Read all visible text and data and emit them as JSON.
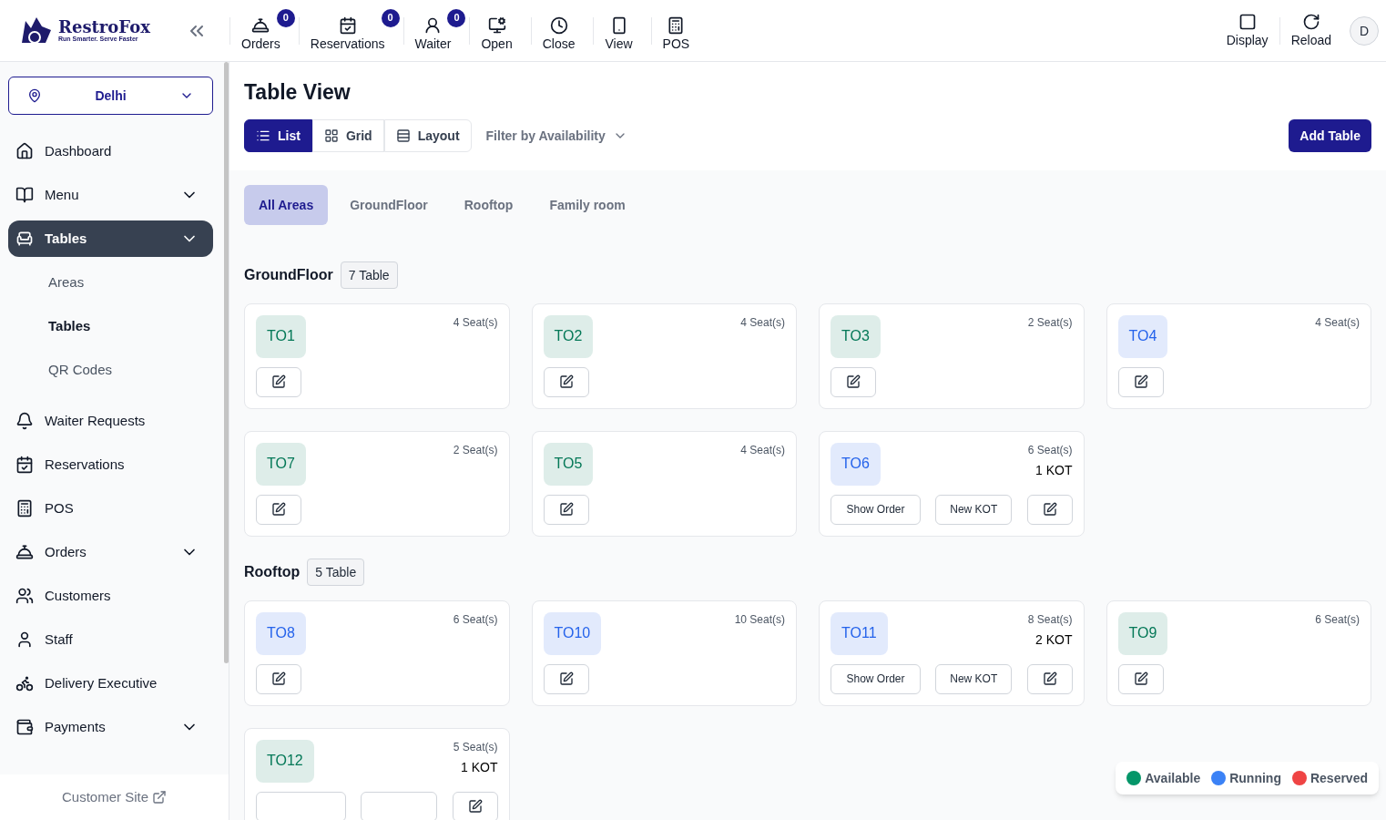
{
  "brand": {
    "name": "RestroFox",
    "tagline": "Run Smarter. Serve Faster"
  },
  "toolbar": [
    {
      "label": "Orders",
      "badge": "0"
    },
    {
      "label": "Reservations",
      "badge": "0"
    },
    {
      "label": "Waiter",
      "badge": "0"
    },
    {
      "label": "Open"
    },
    {
      "label": "Close"
    },
    {
      "label": "View"
    },
    {
      "label": "POS"
    }
  ],
  "toolbar_right": [
    {
      "label": "Display"
    },
    {
      "label": "Reload"
    }
  ],
  "avatar": "D",
  "location": "Delhi",
  "sidebar": {
    "items": [
      {
        "label": "Dashboard",
        "kind": "link",
        "selected": false
      },
      {
        "label": "Menu",
        "kind": "group",
        "selected": false
      },
      {
        "label": "Tables",
        "kind": "group",
        "selected": true,
        "children": [
          {
            "label": "Areas",
            "selected": false
          },
          {
            "label": "Tables",
            "selected": true
          },
          {
            "label": "QR Codes",
            "selected": false
          }
        ]
      },
      {
        "label": "Waiter Requests",
        "kind": "link",
        "selected": false
      },
      {
        "label": "Reservations",
        "kind": "link",
        "selected": false
      },
      {
        "label": "POS",
        "kind": "link",
        "selected": false
      },
      {
        "label": "Orders",
        "kind": "group",
        "selected": false
      },
      {
        "label": "Customers",
        "kind": "link",
        "selected": false
      },
      {
        "label": "Staff",
        "kind": "link",
        "selected": false
      },
      {
        "label": "Delivery Executive",
        "kind": "link",
        "selected": false
      },
      {
        "label": "Payments",
        "kind": "group",
        "selected": false
      }
    ],
    "footer_link": "Customer Site"
  },
  "page_title": "Table View",
  "view_tabs": [
    {
      "label": "List",
      "selected": true
    },
    {
      "label": "Grid",
      "selected": false
    },
    {
      "label": "Layout",
      "selected": false
    }
  ],
  "filter": "Filter by Availability",
  "add_button": "Add Table",
  "area_tabs": [
    {
      "label": "All Areas",
      "selected": true
    },
    {
      "label": "GroundFloor",
      "selected": false
    },
    {
      "label": "Rooftop",
      "selected": false
    },
    {
      "label": "Family room",
      "selected": false
    }
  ],
  "areas": [
    {
      "name": "GroundFloor",
      "count": "7 Table",
      "tables": [
        {
          "code": "TO1",
          "seats": "4 Seat(s)",
          "color": "#047857"
        },
        {
          "code": "TO2",
          "seats": "4 Seat(s)",
          "color": "#047857"
        },
        {
          "code": "TO3",
          "seats": "2 Seat(s)",
          "color": "#047857"
        },
        {
          "code": "TO4",
          "seats": "4 Seat(s)",
          "color": "#2563eb"
        },
        {
          "code": "TO7",
          "seats": "2 Seat(s)",
          "color": "#047857"
        },
        {
          "code": "TO5",
          "seats": "4 Seat(s)",
          "color": "#047857"
        },
        {
          "code": "TO6",
          "seats": "6 Seat(s)",
          "color": "#2563eb",
          "kot": "1 KOT",
          "buttons": [
            "Show Order",
            "New KOT"
          ]
        }
      ]
    },
    {
      "name": "Rooftop",
      "count": "5 Table",
      "tables": [
        {
          "code": "TO8",
          "seats": "6 Seat(s)",
          "color": "#2563eb"
        },
        {
          "code": "TO10",
          "seats": "10 Seat(s)",
          "color": "#2563eb"
        },
        {
          "code": "TO11",
          "seats": "8 Seat(s)",
          "color": "#2563eb",
          "kot": "2 KOT",
          "buttons": [
            "Show Order",
            "New KOT"
          ]
        },
        {
          "code": "TO9",
          "seats": "6 Seat(s)",
          "color": "#047857"
        },
        {
          "code": "TO12",
          "seats": "5 Seat(s)",
          "color": "#047857",
          "kot": "1 KOT"
        }
      ]
    }
  ],
  "legend": [
    {
      "label": "Available",
      "color": "#059669"
    },
    {
      "label": "Running",
      "color": "#3b82f6"
    },
    {
      "label": "Reserved",
      "color": "#ef4444"
    }
  ]
}
